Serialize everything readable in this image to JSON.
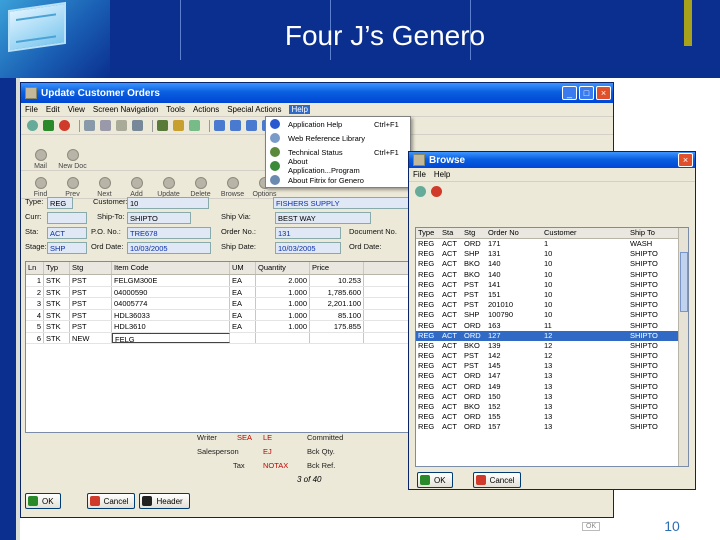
{
  "slide": {
    "title": "Four J’s Genero",
    "page_number": "10",
    "corner_button": "OK"
  },
  "main_window": {
    "title": "Update Customer Orders",
    "menu": [
      "File",
      "Edit",
      "View",
      "Screen Navigation",
      "Tools",
      "Actions",
      "Special Actions",
      "Help"
    ],
    "actions": [
      "Mail",
      "New Doc",
      "Find",
      "Prev",
      "Next",
      "Add",
      "Update",
      "Delete",
      "Browse",
      "Options"
    ],
    "form": {
      "type_label": "Type:",
      "type_value": "REG",
      "customer_label": "Customer:",
      "customer_value": "10",
      "customer_name": "FISHERS SUPPLY",
      "curr_label": "Curr:",
      "shipto_label": "Ship-To:",
      "shipto_value": "SHIPTO",
      "shipvia_label": "Ship Via:",
      "shipvia_value": "BEST WAY",
      "sta_label": "Sta:",
      "sta_value": "ACT",
      "po_label": "P.O. No.:",
      "po_value": "TRE678",
      "order_label": "Order No.:",
      "order_value": "131",
      "docno_label": "Document No.",
      "stage_label": "Stage:",
      "stage_value": "SHP",
      "orddate_label": "Ord Date:",
      "orddate_value": "10/03/2005",
      "shipdate_label": "Ship Date:",
      "shipdate_value": "10/03/2005",
      "orddue_label": "Ord Date:"
    },
    "lines": {
      "headers": [
        "Ln",
        "Typ",
        "Stg",
        "Item Code",
        "UM",
        "Quantity",
        "Price"
      ],
      "rows": [
        [
          "1",
          "STK",
          "PST",
          "FELGM300E",
          "EA",
          "2.000",
          "10.253"
        ],
        [
          "2",
          "STK",
          "PST",
          "04000590",
          "EA",
          "1.000",
          "1,785.600"
        ],
        [
          "3",
          "STK",
          "PST",
          "04005774",
          "EA",
          "1.000",
          "2,201.100"
        ],
        [
          "4",
          "STK",
          "PST",
          "HDL36033",
          "EA",
          "1.000",
          "85.100"
        ],
        [
          "5",
          "STK",
          "PST",
          "HDL3610",
          "EA",
          "1.000",
          "175.855"
        ],
        [
          "6",
          "STK",
          "NEW",
          "FELG",
          "",
          "",
          ""
        ]
      ]
    },
    "summary": {
      "writer_label": "Writer",
      "writer_value": "SEA",
      "writer_value2": "LE",
      "salesperson_label": "Salesperson",
      "salesperson_value": "EJ",
      "tax_label": "Tax",
      "tax_value": "NOTAX",
      "committed_label": "Committed",
      "backqty_label": "Bck Qty.",
      "backref_label": "Bck Ref."
    },
    "status": "3 of 40",
    "buttons": {
      "ok": "OK",
      "cancel": "Cancel",
      "header": "Header"
    }
  },
  "help_menu": {
    "items": [
      {
        "label": "Application Help",
        "shortcut": "Ctrl+F1"
      },
      {
        "label": "Web Reference Library",
        "shortcut": ""
      },
      {
        "label": "Technical Status",
        "shortcut": "Ctrl+F1"
      },
      {
        "label": "About Application...Program",
        "shortcut": ""
      },
      {
        "label": "About Fitrix for Genero",
        "shortcut": ""
      }
    ]
  },
  "browse_window": {
    "title": "Browse",
    "menu": [
      "File",
      "Help"
    ],
    "headers": [
      "Type",
      "Sta",
      "Stg",
      "Order No",
      "Customer",
      "Ship To"
    ],
    "rows": [
      [
        "REG",
        "ACT",
        "ORD",
        "171",
        "1",
        "WASH"
      ],
      [
        "REG",
        "ACT",
        "SHP",
        "131",
        "10",
        "SHIPTO"
      ],
      [
        "REG",
        "ACT",
        "BKO",
        "140",
        "10",
        "SHIPTO"
      ],
      [
        "REG",
        "ACT",
        "BKO",
        "140",
        "10",
        "SHIPTO"
      ],
      [
        "REG",
        "ACT",
        "PST",
        "141",
        "10",
        "SHIPTO"
      ],
      [
        "REG",
        "ACT",
        "PST",
        "151",
        "10",
        "SHIPTO"
      ],
      [
        "REG",
        "ACT",
        "PST",
        "201010",
        "10",
        "SHIPTO"
      ],
      [
        "REG",
        "ACT",
        "SHP",
        "100790",
        "10",
        "SHIPTO"
      ],
      [
        "REG",
        "ACT",
        "ORD",
        "163",
        "11",
        "SHIPTO"
      ],
      [
        "REG",
        "ACT",
        "ORD",
        "127",
        "12",
        "SHIPTO"
      ],
      [
        "REG",
        "ACT",
        "BKO",
        "139",
        "12",
        "SHIPTO"
      ],
      [
        "REG",
        "ACT",
        "PST",
        "142",
        "12",
        "SHIPTO"
      ],
      [
        "REG",
        "ACT",
        "PST",
        "145",
        "13",
        "SHIPTO"
      ],
      [
        "REG",
        "ACT",
        "ORD",
        "147",
        "13",
        "SHIPTO"
      ],
      [
        "REG",
        "ACT",
        "ORD",
        "149",
        "13",
        "SHIPTO"
      ],
      [
        "REG",
        "ACT",
        "ORD",
        "150",
        "13",
        "SHIPTO"
      ],
      [
        "REG",
        "ACT",
        "BKO",
        "152",
        "13",
        "SHIPTO"
      ],
      [
        "REG",
        "ACT",
        "ORD",
        "155",
        "13",
        "SHIPTO"
      ],
      [
        "REG",
        "ACT",
        "ORD",
        "157",
        "13",
        "SHIPTO"
      ]
    ],
    "selected_row": 9,
    "buttons": {
      "ok": "OK",
      "cancel": "Cancel"
    }
  },
  "colors": {
    "slide_blue": "#0b2f8f",
    "selection": "#316ac5",
    "accent_olive": "#a7a11b"
  }
}
